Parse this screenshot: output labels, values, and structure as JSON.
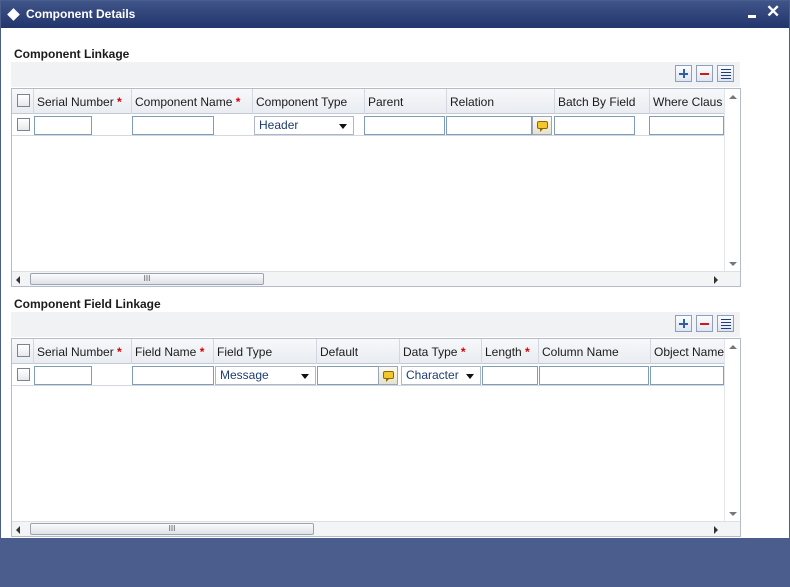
{
  "window": {
    "title": "Component Details",
    "minimize_icon": "minimize-icon",
    "close_icon": "close-icon"
  },
  "component_linkage": {
    "title": "Component Linkage",
    "columns": [
      "Serial Number",
      "Component Name",
      "Component Type",
      "Parent",
      "Relation",
      "Batch By Field",
      "Where Claus"
    ],
    "required": [
      true,
      true,
      false,
      false,
      false,
      false,
      false
    ],
    "row": {
      "serial_number": "",
      "component_name": "",
      "component_type": "Header",
      "parent": "",
      "relation": "",
      "batch_by_field": "",
      "where_clause": ""
    }
  },
  "component_field_linkage": {
    "title": "Component Field Linkage",
    "columns": [
      "Serial Number",
      "Field Name",
      "Field Type",
      "Default",
      "Data Type",
      "Length",
      "Column Name",
      "Object Name"
    ],
    "required": [
      true,
      true,
      false,
      false,
      true,
      true,
      false,
      false
    ],
    "row": {
      "serial_number": "",
      "field_name": "",
      "field_type": "Message",
      "default": "",
      "data_type": "Character",
      "length": "",
      "column_name": "",
      "object_name": ""
    }
  },
  "scroll_thumb_grip": "III",
  "colors": {
    "titlebar": "#2c3f75",
    "footer": "#4b5d8c",
    "required": "#d80000"
  }
}
